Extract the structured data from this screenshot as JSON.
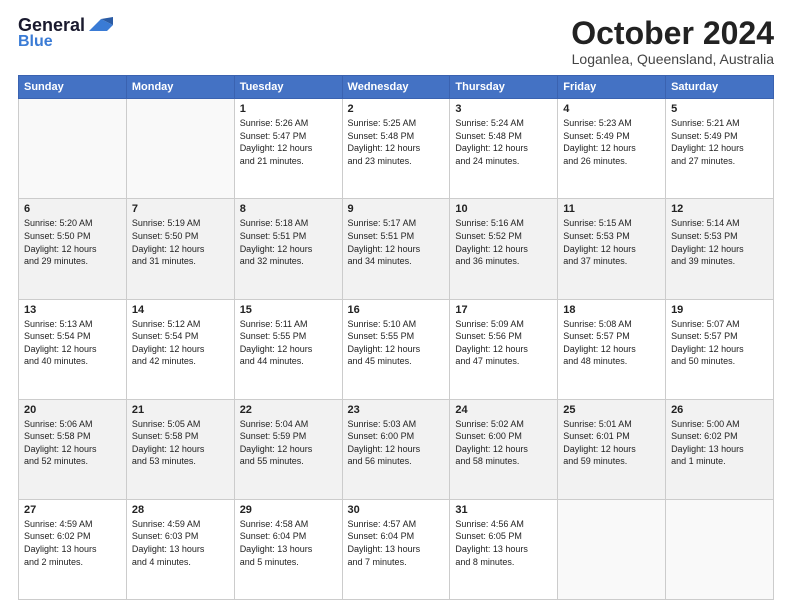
{
  "logo": {
    "line1": "General",
    "line2": "Blue"
  },
  "title": "October 2024",
  "subtitle": "Loganlea, Queensland, Australia",
  "weekdays": [
    "Sunday",
    "Monday",
    "Tuesday",
    "Wednesday",
    "Thursday",
    "Friday",
    "Saturday"
  ],
  "weeks": [
    [
      {
        "day": "",
        "info": ""
      },
      {
        "day": "",
        "info": ""
      },
      {
        "day": "1",
        "info": "Sunrise: 5:26 AM\nSunset: 5:47 PM\nDaylight: 12 hours\nand 21 minutes."
      },
      {
        "day": "2",
        "info": "Sunrise: 5:25 AM\nSunset: 5:48 PM\nDaylight: 12 hours\nand 23 minutes."
      },
      {
        "day": "3",
        "info": "Sunrise: 5:24 AM\nSunset: 5:48 PM\nDaylight: 12 hours\nand 24 minutes."
      },
      {
        "day": "4",
        "info": "Sunrise: 5:23 AM\nSunset: 5:49 PM\nDaylight: 12 hours\nand 26 minutes."
      },
      {
        "day": "5",
        "info": "Sunrise: 5:21 AM\nSunset: 5:49 PM\nDaylight: 12 hours\nand 27 minutes."
      }
    ],
    [
      {
        "day": "6",
        "info": "Sunrise: 5:20 AM\nSunset: 5:50 PM\nDaylight: 12 hours\nand 29 minutes."
      },
      {
        "day": "7",
        "info": "Sunrise: 5:19 AM\nSunset: 5:50 PM\nDaylight: 12 hours\nand 31 minutes."
      },
      {
        "day": "8",
        "info": "Sunrise: 5:18 AM\nSunset: 5:51 PM\nDaylight: 12 hours\nand 32 minutes."
      },
      {
        "day": "9",
        "info": "Sunrise: 5:17 AM\nSunset: 5:51 PM\nDaylight: 12 hours\nand 34 minutes."
      },
      {
        "day": "10",
        "info": "Sunrise: 5:16 AM\nSunset: 5:52 PM\nDaylight: 12 hours\nand 36 minutes."
      },
      {
        "day": "11",
        "info": "Sunrise: 5:15 AM\nSunset: 5:53 PM\nDaylight: 12 hours\nand 37 minutes."
      },
      {
        "day": "12",
        "info": "Sunrise: 5:14 AM\nSunset: 5:53 PM\nDaylight: 12 hours\nand 39 minutes."
      }
    ],
    [
      {
        "day": "13",
        "info": "Sunrise: 5:13 AM\nSunset: 5:54 PM\nDaylight: 12 hours\nand 40 minutes."
      },
      {
        "day": "14",
        "info": "Sunrise: 5:12 AM\nSunset: 5:54 PM\nDaylight: 12 hours\nand 42 minutes."
      },
      {
        "day": "15",
        "info": "Sunrise: 5:11 AM\nSunset: 5:55 PM\nDaylight: 12 hours\nand 44 minutes."
      },
      {
        "day": "16",
        "info": "Sunrise: 5:10 AM\nSunset: 5:55 PM\nDaylight: 12 hours\nand 45 minutes."
      },
      {
        "day": "17",
        "info": "Sunrise: 5:09 AM\nSunset: 5:56 PM\nDaylight: 12 hours\nand 47 minutes."
      },
      {
        "day": "18",
        "info": "Sunrise: 5:08 AM\nSunset: 5:57 PM\nDaylight: 12 hours\nand 48 minutes."
      },
      {
        "day": "19",
        "info": "Sunrise: 5:07 AM\nSunset: 5:57 PM\nDaylight: 12 hours\nand 50 minutes."
      }
    ],
    [
      {
        "day": "20",
        "info": "Sunrise: 5:06 AM\nSunset: 5:58 PM\nDaylight: 12 hours\nand 52 minutes."
      },
      {
        "day": "21",
        "info": "Sunrise: 5:05 AM\nSunset: 5:58 PM\nDaylight: 12 hours\nand 53 minutes."
      },
      {
        "day": "22",
        "info": "Sunrise: 5:04 AM\nSunset: 5:59 PM\nDaylight: 12 hours\nand 55 minutes."
      },
      {
        "day": "23",
        "info": "Sunrise: 5:03 AM\nSunset: 6:00 PM\nDaylight: 12 hours\nand 56 minutes."
      },
      {
        "day": "24",
        "info": "Sunrise: 5:02 AM\nSunset: 6:00 PM\nDaylight: 12 hours\nand 58 minutes."
      },
      {
        "day": "25",
        "info": "Sunrise: 5:01 AM\nSunset: 6:01 PM\nDaylight: 12 hours\nand 59 minutes."
      },
      {
        "day": "26",
        "info": "Sunrise: 5:00 AM\nSunset: 6:02 PM\nDaylight: 13 hours\nand 1 minute."
      }
    ],
    [
      {
        "day": "27",
        "info": "Sunrise: 4:59 AM\nSunset: 6:02 PM\nDaylight: 13 hours\nand 2 minutes."
      },
      {
        "day": "28",
        "info": "Sunrise: 4:59 AM\nSunset: 6:03 PM\nDaylight: 13 hours\nand 4 minutes."
      },
      {
        "day": "29",
        "info": "Sunrise: 4:58 AM\nSunset: 6:04 PM\nDaylight: 13 hours\nand 5 minutes."
      },
      {
        "day": "30",
        "info": "Sunrise: 4:57 AM\nSunset: 6:04 PM\nDaylight: 13 hours\nand 7 minutes."
      },
      {
        "day": "31",
        "info": "Sunrise: 4:56 AM\nSunset: 6:05 PM\nDaylight: 13 hours\nand 8 minutes."
      },
      {
        "day": "",
        "info": ""
      },
      {
        "day": "",
        "info": ""
      }
    ]
  ]
}
